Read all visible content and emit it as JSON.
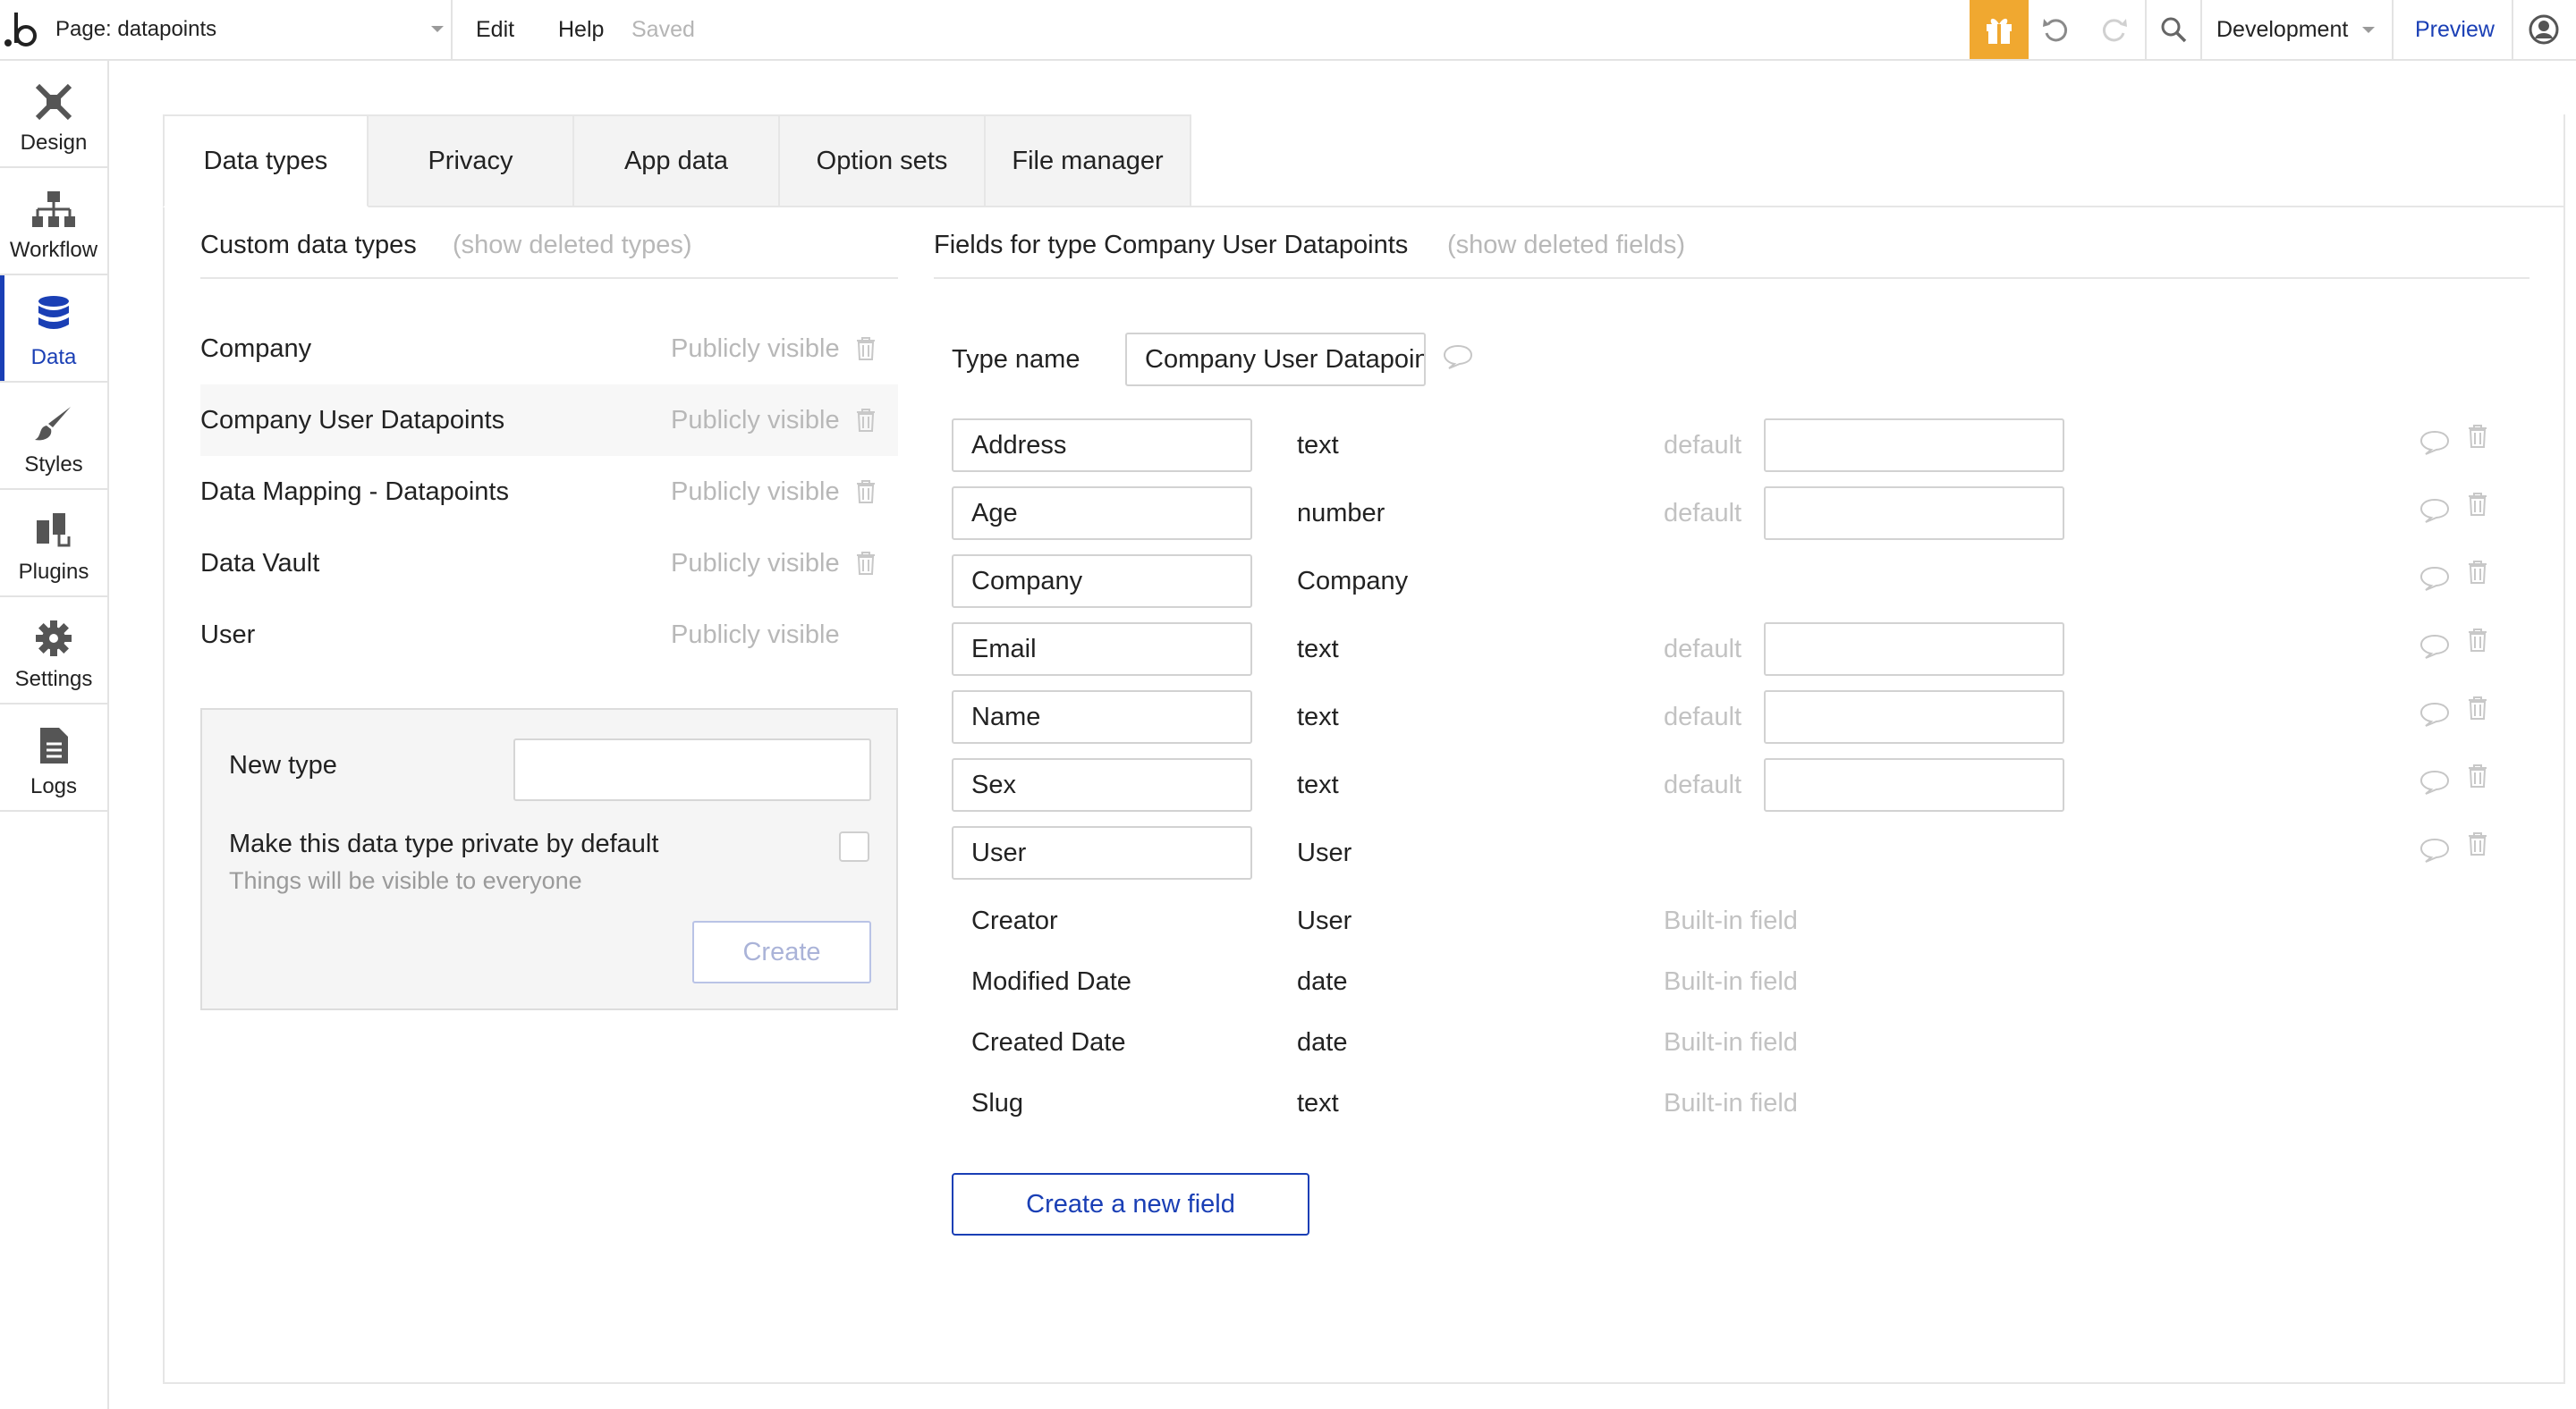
{
  "topbar": {
    "page_label": "Page: datapoints",
    "menu_edit": "Edit",
    "menu_help": "Help",
    "status": "Saved",
    "environment": "Development",
    "preview": "Preview",
    "accent_color": "#f0a830",
    "icons": [
      "bubble-logo-icon",
      "chevron-down-icon",
      "gift-icon",
      "undo-icon",
      "redo-icon",
      "search-icon",
      "user-avatar-icon"
    ]
  },
  "sidebar": {
    "items": [
      {
        "label": "Design",
        "icon": "design-icon"
      },
      {
        "label": "Workflow",
        "icon": "workflow-icon"
      },
      {
        "label": "Data",
        "icon": "database-icon",
        "active": true
      },
      {
        "label": "Styles",
        "icon": "brush-icon"
      },
      {
        "label": "Plugins",
        "icon": "plugin-icon"
      },
      {
        "label": "Settings",
        "icon": "gear-icon"
      },
      {
        "label": "Logs",
        "icon": "document-icon"
      }
    ],
    "active_color": "#1a3fb5"
  },
  "tabs": [
    {
      "label": "Data types",
      "active": true
    },
    {
      "label": "Privacy"
    },
    {
      "label": "App data"
    },
    {
      "label": "Option sets"
    },
    {
      "label": "File manager"
    }
  ],
  "types_panel": {
    "heading": "Custom data types",
    "show_deleted": "(show deleted types)",
    "types": [
      {
        "name": "Company",
        "visibility": "Publicly visible",
        "deletable": true
      },
      {
        "name": "Company User Datapoints",
        "visibility": "Publicly visible",
        "deletable": true
      },
      {
        "name": "Data Mapping - Datapoints",
        "visibility": "Publicly visible",
        "deletable": true
      },
      {
        "name": "Data Vault",
        "visibility": "Publicly visible",
        "deletable": true
      },
      {
        "name": "User",
        "visibility": "Publicly visible",
        "deletable": false
      }
    ],
    "new_type": {
      "label": "New type",
      "value": "",
      "private_label": "Make this data type private by default",
      "private_checked": false,
      "hint": "Things will be visible to everyone",
      "create_button": "Create"
    }
  },
  "fields_panel": {
    "heading": "Fields for type Company User Datapoints",
    "show_deleted": "(show deleted fields)",
    "type_name_label": "Type name",
    "type_name_value": "Company User Datapoints",
    "default_label": "default",
    "fields": [
      {
        "name": "Address",
        "type": "text",
        "has_default": true
      },
      {
        "name": "Age",
        "type": "number",
        "has_default": true
      },
      {
        "name": "Company",
        "type": "Company",
        "has_default": false
      },
      {
        "name": "Email",
        "type": "text",
        "has_default": true
      },
      {
        "name": "Name",
        "type": "text",
        "has_default": true
      },
      {
        "name": "Sex",
        "type": "text",
        "has_default": true
      },
      {
        "name": "User",
        "type": "User",
        "has_default": false
      }
    ],
    "builtin_label": "Built-in field",
    "builtin_fields": [
      {
        "name": "Creator",
        "type": "User"
      },
      {
        "name": "Modified Date",
        "type": "date"
      },
      {
        "name": "Created Date",
        "type": "date"
      },
      {
        "name": "Slug",
        "type": "text"
      }
    ],
    "create_field_button": "Create a new field"
  }
}
